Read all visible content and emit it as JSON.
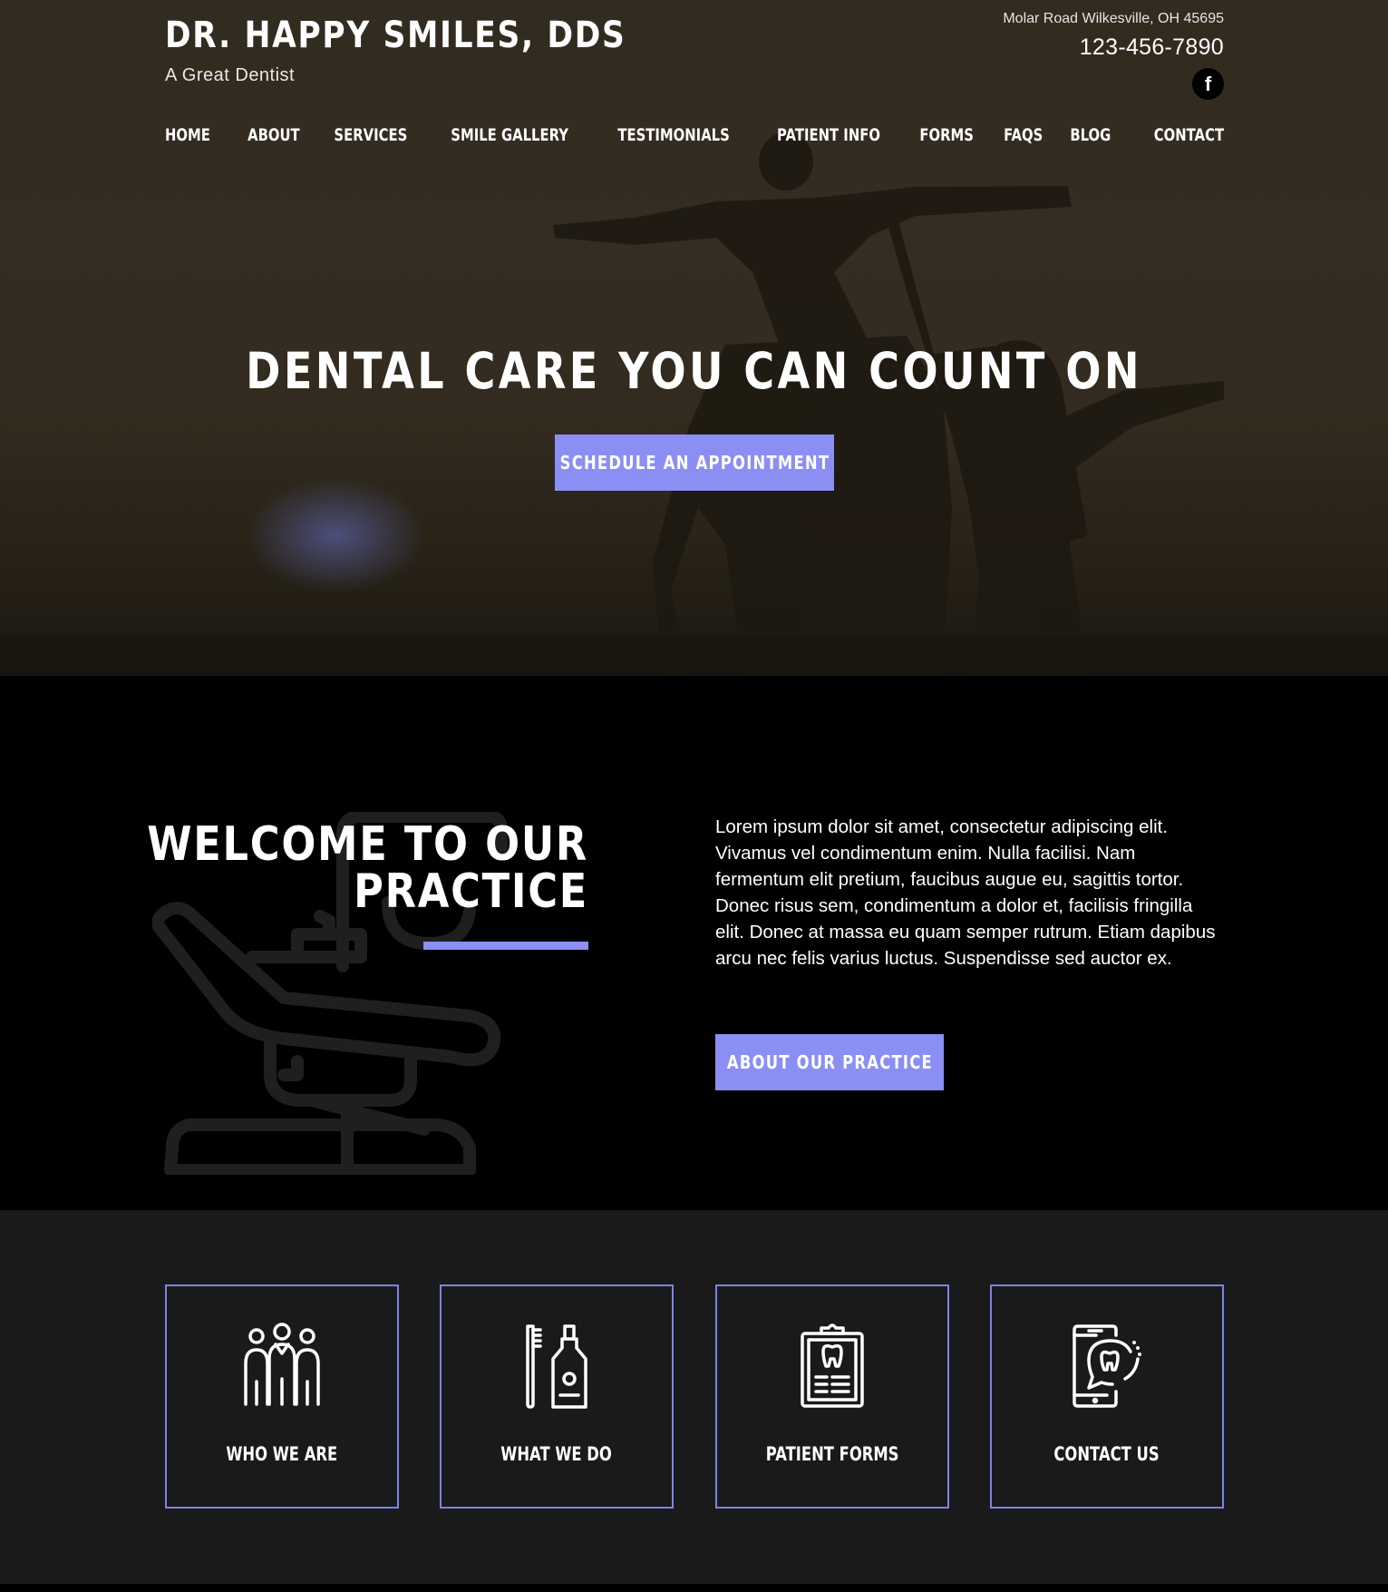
{
  "header": {
    "brand_name": "DR. HAPPY SMILES, DDS",
    "tagline": "A Great Dentist",
    "address": "Molar Road Wilkesville, OH 45695",
    "phone": "123-456-7890",
    "social_icon": "facebook-icon"
  },
  "nav": {
    "items": [
      "HOME",
      "ABOUT",
      "SERVICES",
      "SMILE GALLERY",
      "TESTIMONIALS",
      "PATIENT INFO",
      "FORMS",
      "FAQS",
      "BLOG",
      "CONTACT"
    ]
  },
  "hero": {
    "title": "DENTAL CARE YOU CAN COUNT ON",
    "cta_label": "SCHEDULE AN APPOINTMENT"
  },
  "welcome": {
    "title": "WELCOME TO OUR\nPRACTICE",
    "body": "Lorem ipsum dolor sit amet, consectetur adipiscing elit. Vivamus vel condimentum enim. Nulla facilisi. Nam fermentum elit pretium, faucibus augue eu, sagittis tortor. Donec risus sem, condimentum a dolor et, facilisis fringilla elit. Donec at massa eu quam semper rutrum. Etiam dapibus arcu nec felis varius luctus. Suspendisse sed auctor ex.",
    "button_label": "ABOUT OUR PRACTICE",
    "background_icon": "dental-chair-icon"
  },
  "cards": [
    {
      "label": "WHO WE ARE",
      "icon": "team-icon"
    },
    {
      "label": "WHAT WE DO",
      "icon": "toothbrush-toothpaste-icon"
    },
    {
      "label": "PATIENT FORMS",
      "icon": "clipboard-tooth-icon"
    },
    {
      "label": "CONTACT US",
      "icon": "phone-tooth-icon"
    }
  ],
  "colors": {
    "accent": "#8b8ff4",
    "card_border": "#7d83e8",
    "card_section_bg": "#1a1a1b",
    "welcome_bg": "#000000"
  }
}
